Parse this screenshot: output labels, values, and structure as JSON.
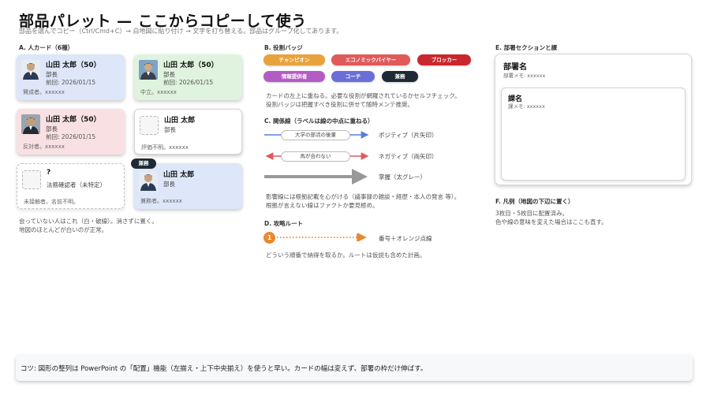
{
  "header": {
    "title": "部品パレット — ここからコピーして使う",
    "subtitle": "部品を選んでコピー（Ctrl/Cmd+C）→ 白地図に貼り付け → 文字を打ち替える。部品はグループ化してあります。"
  },
  "section_a": {
    "label": "A. 人カード（6種）",
    "cards": [
      {
        "name": "山田 太郎（50）",
        "title": "部長",
        "date": "前回: 2026/01/15",
        "note": "賛成者。xxxxxx"
      },
      {
        "name": "山田 太郎（50）",
        "title": "部長",
        "date": "前回: 2026/01/15",
        "note": "中立。xxxxxx"
      },
      {
        "name": "山田 太郎（50）",
        "title": "部長",
        "date": "前回: 2026/01/15",
        "note": "反対者。xxxxxx"
      },
      {
        "name": "山田 太郎",
        "title": "部長",
        "note": "評価不明。xxxxxx"
      },
      {
        "name": "?",
        "title": "法務確認者（未特定）",
        "note": "未接触者。名前不明。"
      },
      {
        "name": "山田 太郎",
        "title": "部長",
        "note": "兼務者。xxxxxx"
      }
    ],
    "kenmu_badge": "兼務",
    "note_line1": "会っていない人はこれ（白・破線）。消さずに置く。",
    "note_line2": "地図のほとんどが白いのが正常。"
  },
  "section_b": {
    "label": "B. 役割バッジ",
    "badges": [
      {
        "label": "チャンピオン",
        "color": "#e9a23b"
      },
      {
        "label": "エコノミックバイヤー",
        "color": "#e05a5a"
      },
      {
        "label": "ブロッカー",
        "color": "#c8282d"
      },
      {
        "label": "情報提供者",
        "color": "#b45cc4"
      },
      {
        "label": "コーチ",
        "color": "#6a6fd8"
      },
      {
        "label": "兼務",
        "color": "#1e2a36"
      }
    ],
    "note_line1": "カードの左上に重ねる。必要な役割が網羅されているかセルフチェック。",
    "note_line2": "役割バッジは把握すべき役割に併せて随時メンテ推奨。"
  },
  "section_c": {
    "label": "C. 関係線（ラベルは線の中点に重ねる）",
    "lines": [
      {
        "pill": "大学の部活の後輩",
        "desc": "ポジティブ（片矢印）",
        "color": "#5a7fd6"
      },
      {
        "pill": "馬が合わない",
        "desc": "ネガティブ（両矢印）",
        "color": "#e05a5a"
      },
      {
        "pill": "",
        "desc": "掌握（太グレー）",
        "color": "#999999"
      }
    ],
    "note_line1": "影響線には根拠記載を心がける（議事録の雑談・経歴・本人の発言 等）。",
    "note_line2": "根拠が言えない線はファクトか要見極め。"
  },
  "section_d": {
    "label": "D. 攻略ルート",
    "number": "1",
    "desc": "番号＋オレンジ点線",
    "note": "どういう順番で納得を取るか。ルートは仮説も含めた計画。",
    "color": "#e8892f"
  },
  "section_e": {
    "label": "E. 部署セクションと課",
    "dept_name": "部署名",
    "dept_memo": "部署メモ: xxxxxx",
    "sect_name": "課名",
    "sect_memo": "課メモ: xxxxxx"
  },
  "section_f": {
    "label": "F. 凡例（地図の下辺に置く）",
    "note_line1": "3枚目・5枚目に配置済み。",
    "note_line2": "色や線の意味を変えた場合はここも直す。"
  },
  "tip": {
    "text": "コツ: 図形の整列は PowerPoint の「配置」機能（左揃え・上下中央揃え）を使うと早い。カードの幅は変えず、部署の枠だけ伸ばす。"
  }
}
